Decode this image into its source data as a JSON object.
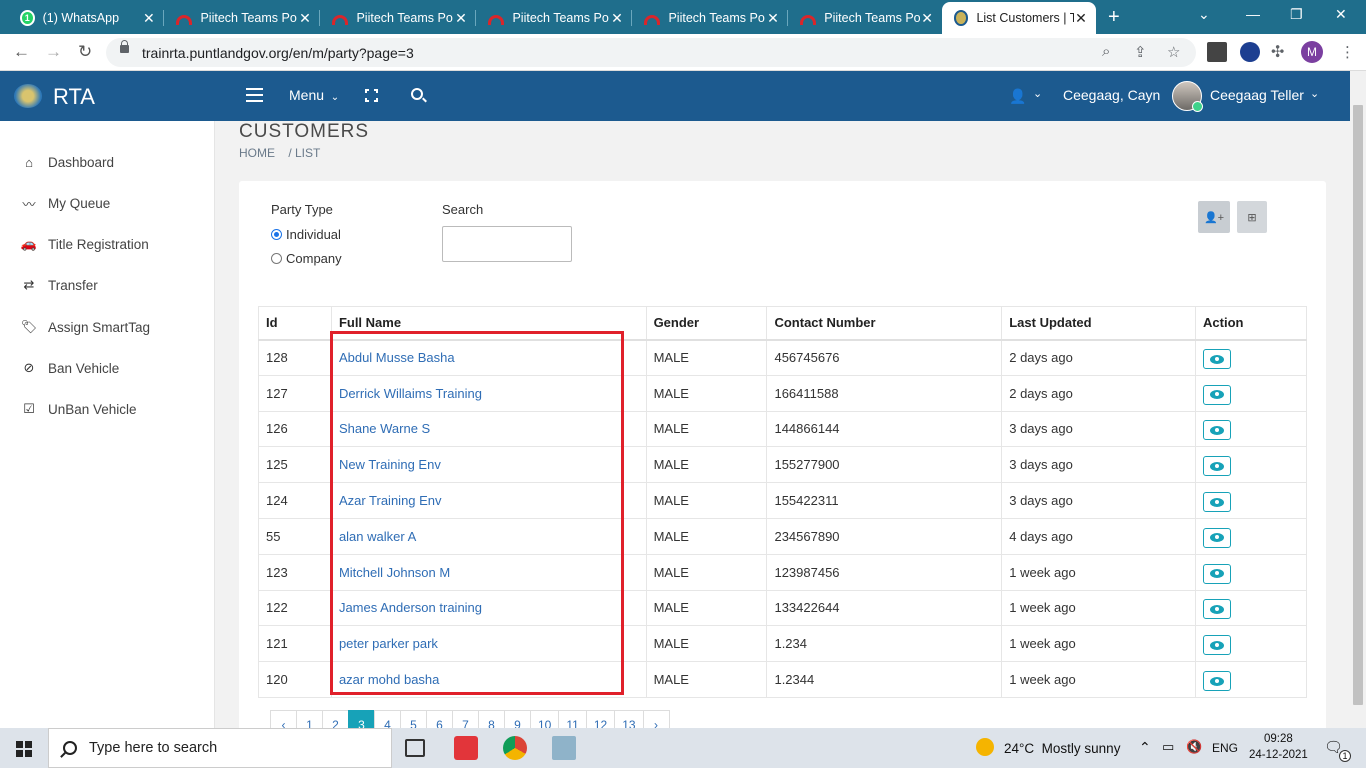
{
  "browser": {
    "tabs": [
      {
        "title": "(1) WhatsApp",
        "icon": "whatsapp-icon"
      },
      {
        "title": "Piitech Teams Po",
        "icon": "teams-icon"
      },
      {
        "title": "Piitech Teams Po",
        "icon": "teams-icon"
      },
      {
        "title": "Piitech Teams Po",
        "icon": "teams-icon"
      },
      {
        "title": "Piitech Teams Po",
        "icon": "teams-icon"
      },
      {
        "title": "Piitech Teams Po",
        "icon": "teams-icon"
      },
      {
        "title": "List Customers | T",
        "icon": "rta-emblem-icon",
        "active": true
      }
    ],
    "url": "trainrta.puntlandgov.org/en/m/party?page=3",
    "profile_initial": "M"
  },
  "header": {
    "brand": "RTA",
    "menu_label": "Menu",
    "user_name": "Ceegaag, Cayn",
    "user_role": "Ceegaag Teller"
  },
  "sidebar": {
    "items": [
      {
        "label": "Dashboard",
        "icon": "home-icon"
      },
      {
        "label": "My Queue",
        "icon": "trend-icon"
      },
      {
        "label": "Title Registration",
        "icon": "car-icon"
      },
      {
        "label": "Transfer",
        "icon": "exchange-icon"
      },
      {
        "label": "Assign SmartTag",
        "icon": "tags-icon"
      },
      {
        "label": "Ban Vehicle",
        "icon": "ban-icon"
      },
      {
        "label": "UnBan Vehicle",
        "icon": "check-square-icon"
      }
    ]
  },
  "page": {
    "title": "CUSTOMERS",
    "breadcrumb": [
      "HOME",
      "/ LIST"
    ]
  },
  "filters": {
    "party_type_label": "Party Type",
    "options": [
      "Individual",
      "Company"
    ],
    "selected": "Individual",
    "search_label": "Search",
    "search_value": ""
  },
  "table": {
    "columns": [
      "Id",
      "Full Name",
      "Gender",
      "Contact Number",
      "Last Updated",
      "Action"
    ],
    "rows": [
      {
        "id": "128",
        "name": "Abdul Musse Basha",
        "gender": "MALE",
        "contact": "456745676",
        "updated": "2 days ago"
      },
      {
        "id": "127",
        "name": "Derrick Willaims Training",
        "gender": "MALE",
        "contact": "166411588",
        "updated": "2 days ago"
      },
      {
        "id": "126",
        "name": "Shane Warne S",
        "gender": "MALE",
        "contact": "144866144",
        "updated": "3 days ago"
      },
      {
        "id": "125",
        "name": "New Training Env",
        "gender": "MALE",
        "contact": "155277900",
        "updated": "3 days ago"
      },
      {
        "id": "124",
        "name": "Azar Training Env",
        "gender": "MALE",
        "contact": "155422311",
        "updated": "3 days ago"
      },
      {
        "id": "55",
        "name": "alan walker A",
        "gender": "MALE",
        "contact": "234567890",
        "updated": "4 days ago"
      },
      {
        "id": "123",
        "name": "Mitchell Johnson M",
        "gender": "MALE",
        "contact": "123987456",
        "updated": "1 week ago"
      },
      {
        "id": "122",
        "name": "James Anderson training",
        "gender": "MALE",
        "contact": "133422644",
        "updated": "1 week ago"
      },
      {
        "id": "121",
        "name": "peter parker park",
        "gender": "MALE",
        "contact": "1.234",
        "updated": "1 week ago"
      },
      {
        "id": "120",
        "name": "azar mohd basha",
        "gender": "MALE",
        "contact": "1.2344",
        "updated": "1 week ago"
      }
    ]
  },
  "pagination": {
    "prev": "‹",
    "pages": [
      "1",
      "2",
      "3",
      "4",
      "5",
      "6",
      "7",
      "8",
      "9",
      "10",
      "11",
      "12",
      "13"
    ],
    "current": "3",
    "next": "›"
  },
  "taskbar": {
    "search_placeholder": "Type here to search",
    "weather": "24°C  Mostly sunny",
    "language": "ENG",
    "time": "09:28",
    "date": "24-12-2021",
    "notification_count": "1"
  },
  "colors": {
    "tab_strip": "#1f6e8c",
    "app_header": "#1c5a8f",
    "accent": "#17a2b8",
    "link": "#2f6db5",
    "highlight": "#e0202a"
  }
}
